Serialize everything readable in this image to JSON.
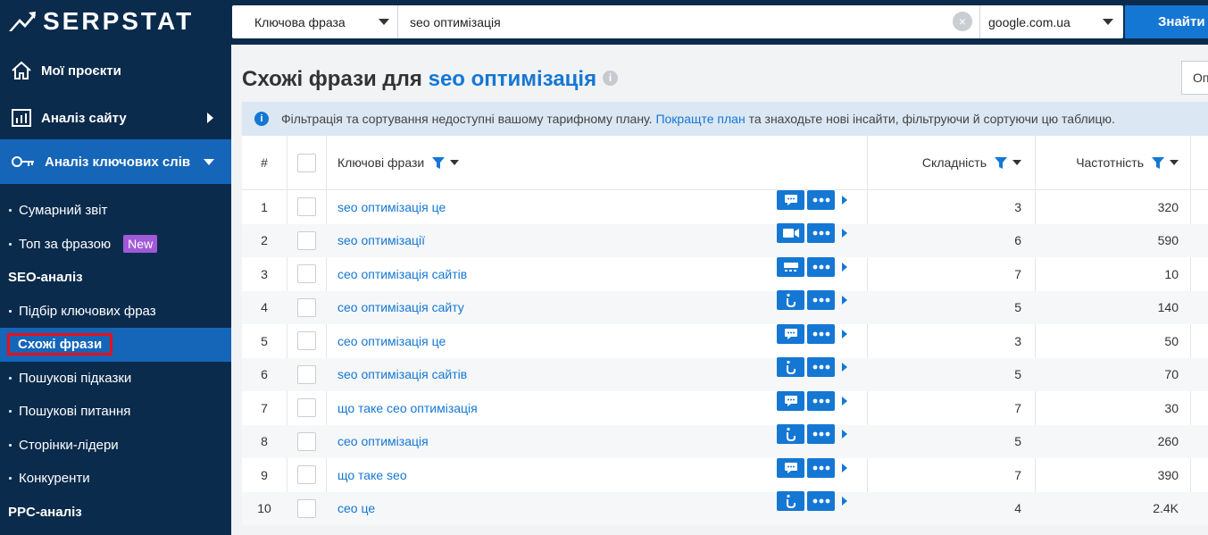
{
  "app": {
    "brand": "SERPSTAT"
  },
  "search": {
    "mode": "Ключова фраза",
    "query": "seo оптимізація",
    "database": "google.com.ua",
    "submit_label": "Знайти"
  },
  "sidebar": {
    "main": [
      {
        "label": "Мої проєкти",
        "icon": "home-icon"
      },
      {
        "label": "Аналіз сайту",
        "icon": "chart-icon"
      },
      {
        "label": "Аналіз ключових слів",
        "icon": "key-icon"
      }
    ],
    "sub": {
      "summary": "Сумарний звіт",
      "top": "Топ за фразою",
      "new_badge": "New",
      "seo_section": "SEO-аналіз",
      "keyword_selection": "Підбір ключових фраз",
      "similar": "Схожі фрази",
      "suggestions": "Пошукові підказки",
      "questions": "Пошукові питання",
      "leaders": "Сторінки-лідери",
      "competitors": "Конкуренти",
      "ppc_section": "PPC-аналіз"
    }
  },
  "page": {
    "title_prefix": "Схожі фрази для",
    "title_keyword": "seo оптимізація",
    "options_label": "Оп",
    "notice_text": "Фільтрація та сортування недоступні вашому тарифному плану.",
    "notice_link": "Покращте план",
    "notice_rest": "та знаходьте нові інсайти, фільтруючи й сортуючи цю таблицю."
  },
  "table": {
    "columns": {
      "num": "#",
      "keyword": "Ключові фрази",
      "difficulty": "Складність",
      "frequency": "Частотність"
    },
    "rows": [
      {
        "n": "1",
        "kw": "seo оптимізація це",
        "icon": "chat-icon",
        "diff": "3",
        "freq": "320"
      },
      {
        "n": "2",
        "kw": "seo оптимізації",
        "icon": "video-icon",
        "diff": "6",
        "freq": "590"
      },
      {
        "n": "3",
        "kw": "сео оптимізація сайтів",
        "icon": "carousel-icon",
        "diff": "7",
        "freq": "10"
      },
      {
        "n": "4",
        "kw": "сео оптимізація сайту",
        "icon": "info-icon",
        "diff": "5",
        "freq": "140"
      },
      {
        "n": "5",
        "kw": "сео оптимізація це",
        "icon": "chat-icon",
        "diff": "3",
        "freq": "50"
      },
      {
        "n": "6",
        "kw": "seo оптимізація сайтів",
        "icon": "info-icon",
        "diff": "5",
        "freq": "70"
      },
      {
        "n": "7",
        "kw": "що таке сео оптимізація",
        "icon": "chat-icon",
        "diff": "7",
        "freq": "30"
      },
      {
        "n": "8",
        "kw": "сео оптимізація",
        "icon": "info-icon",
        "diff": "5",
        "freq": "260"
      },
      {
        "n": "9",
        "kw": "що таке seo",
        "icon": "chat-icon",
        "diff": "7",
        "freq": "390"
      },
      {
        "n": "10",
        "kw": "сео це",
        "icon": "info-icon",
        "diff": "4",
        "freq": "2.4K"
      }
    ]
  }
}
